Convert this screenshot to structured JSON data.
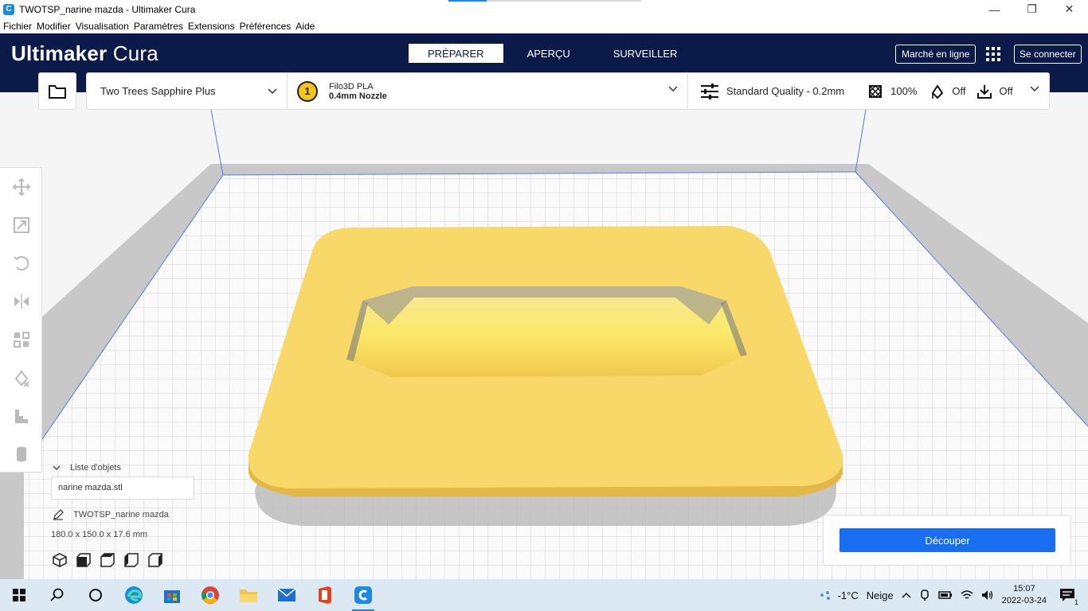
{
  "window": {
    "title": "TWOTSP_narine mazda - Ultimaker Cura",
    "minimize": "—",
    "maximize": "❐",
    "close": "✕"
  },
  "menu": [
    "Fichier",
    "Modifier",
    "Visualisation",
    "Paramètres",
    "Extensions",
    "Préférences",
    "Aide"
  ],
  "header": {
    "logo_bold": "Ultimaker",
    "logo_light": "Cura",
    "tabs": [
      "PRÉPARER",
      "APERÇU",
      "SURVEILLER"
    ],
    "active_tab": "PRÉPARER",
    "marketplace_label": "Marché en ligne",
    "login_label": "Se connecter"
  },
  "printer": {
    "name": "Two Trees Sapphire Plus",
    "extruder_number": "1",
    "material": "Filo3D PLA",
    "nozzle": "0.4mm Nozzle",
    "profile": "Standard Quality - 0.2mm",
    "infill": "100%",
    "support": "Off",
    "adhesion": "Off"
  },
  "object_list": {
    "title": "Liste d'objets",
    "items": [
      "narine mazda.stl"
    ],
    "job_name": "TWOTSP_narine mazda",
    "dimensions": "180.0 x 150.0 x 17.6 mm"
  },
  "slice": {
    "button_label": "Découper"
  },
  "taskbar": {
    "weather_temp": "-1°C",
    "weather_text": "Neige",
    "time": "15:07",
    "date": "2022-03-24",
    "notification_count": "1"
  },
  "colors": {
    "header_bg": "#0c1a4a",
    "slice_button": "#196ef0",
    "model_yellow": "#f8d568",
    "build_plate_line": "#5b7be0"
  }
}
